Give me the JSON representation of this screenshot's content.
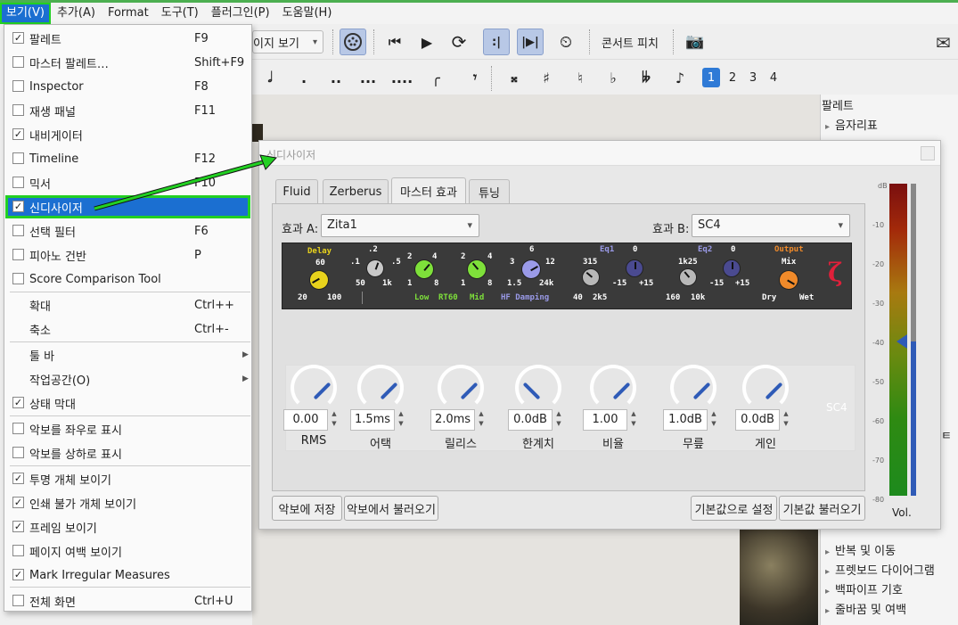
{
  "menubar": {
    "items": [
      "보기(V)",
      "추가(A)",
      "Format",
      "도구(T)",
      "플러그인(P)",
      "도움말(H)"
    ]
  },
  "toolbar": {
    "view_mode": "이지 보기",
    "concert_pitch": "콘서트 피치",
    "durations": [
      ".",
      "..",
      "...",
      "...."
    ],
    "voices": [
      "1",
      "2",
      "3",
      "4"
    ]
  },
  "view_menu": {
    "items": [
      {
        "label": "팔레트",
        "shortcut": "F9",
        "checked": true
      },
      {
        "label": "마스터 팔레트…",
        "shortcut": "Shift+F9",
        "checked": false
      },
      {
        "label": "Inspector",
        "shortcut": "F8",
        "checked": false
      },
      {
        "label": "재생 패널",
        "shortcut": "F11",
        "checked": false
      },
      {
        "label": "내비게이터",
        "shortcut": "",
        "checked": true
      },
      {
        "label": "Timeline",
        "shortcut": "F12",
        "checked": false
      },
      {
        "label": "믹서",
        "shortcut": "F10",
        "checked": false
      },
      {
        "label": "신디사이저",
        "shortcut": "",
        "checked": true
      },
      {
        "label": "선택 필터",
        "shortcut": "F6",
        "checked": false
      },
      {
        "label": "피아노 건반",
        "shortcut": "P",
        "checked": false
      },
      {
        "label": "Score Comparison Tool",
        "shortcut": "",
        "checked": false
      },
      {
        "label": "확대",
        "shortcut": "Ctrl++"
      },
      {
        "label": "축소",
        "shortcut": "Ctrl+-"
      },
      {
        "label": "툴 바",
        "submenu": true
      },
      {
        "label": "작업공간(O)",
        "submenu": true
      },
      {
        "label": "상태 막대",
        "checked": true
      },
      {
        "label": "악보를 좌우로 표시",
        "checked": false
      },
      {
        "label": "악보를 상하로 표시",
        "checked": false
      },
      {
        "label": "투명 개체 보이기",
        "checked": true
      },
      {
        "label": "인쇄 불가 개체 보이기",
        "checked": true
      },
      {
        "label": "프레임 보이기",
        "checked": true
      },
      {
        "label": "페이지 여백 보이기",
        "checked": false
      },
      {
        "label": "Mark Irregular Measures",
        "checked": true
      },
      {
        "label": "전체 화면",
        "shortcut": "Ctrl+U",
        "checked": false
      }
    ]
  },
  "synth": {
    "title": "신디사이저",
    "tabs": [
      "Fluid",
      "Zerberus",
      "마스터 효과",
      "튜닝"
    ],
    "effect_a_label": "효과 A:",
    "effect_a_value": "Zita1",
    "effect_b_label": "효과 B:",
    "effect_b_value": "SC4",
    "zita": {
      "delay": "Delay",
      "d60": "60",
      "d20": "20",
      "d100": "100",
      "rt_labels": [
        ".1",
        ".2",
        ".5",
        "50",
        "1k"
      ],
      "g2": "2",
      "g4": "4",
      "g1": "1",
      "g8": "8",
      "g6": "6",
      "g3": "3",
      "g12": "12",
      "g15": "1.5",
      "g24k": "24k",
      "low": "Low",
      "rt60": "RT60",
      "mid": "Mid",
      "hf": "HF Damping",
      "eq1": "Eq1",
      "eq2": "Eq2",
      "e315": "315",
      "e0": "0",
      "e40": "40",
      "e2k5": "2k5",
      "em15": "-15",
      "ep15": "+15",
      "e1k25": "1k25",
      "e160": "160",
      "e10k": "10k",
      "output": "Output",
      "mix": "Mix",
      "dry": "Dry",
      "wet": "Wet"
    },
    "sc4_label": "SC4",
    "params": [
      {
        "value": "0.00",
        "label": "RMS"
      },
      {
        "value": "1.5ms",
        "label": "어택"
      },
      {
        "value": "2.0ms",
        "label": "릴리스"
      },
      {
        "value": "0.0dB",
        "label": "한계치"
      },
      {
        "value": "1.00",
        "label": "비율"
      },
      {
        "value": "1.0dB",
        "label": "무릎"
      },
      {
        "value": "0.0dB",
        "label": "게인"
      }
    ],
    "buttons": {
      "save": "악보에 저장",
      "load": "악보에서 불러오기",
      "set_default": "기본값으로 설정",
      "load_default": "기본값 불러오기"
    },
    "meter": {
      "labels": [
        "dB",
        "-10",
        "-20",
        "-30",
        "-40",
        "-50",
        "-60",
        "-70",
        "-80"
      ],
      "vol": "Vol."
    }
  },
  "palette": {
    "title": "팔레트",
    "items": [
      "음자리표",
      "반복 및 이동",
      "프렛보드 다이어그램",
      "백파이프 기호",
      "줄바꿈 및 여백"
    ],
    "partial_item": "ㅌ"
  },
  "colors": {
    "highlight": "#1b6fd1",
    "annotation": "#22d022",
    "knob_yellow": "#e8d21c",
    "knob_green": "#7ee03a",
    "knob_lavender": "#9a9ae8",
    "knob_orange": "#f08a2a"
  }
}
